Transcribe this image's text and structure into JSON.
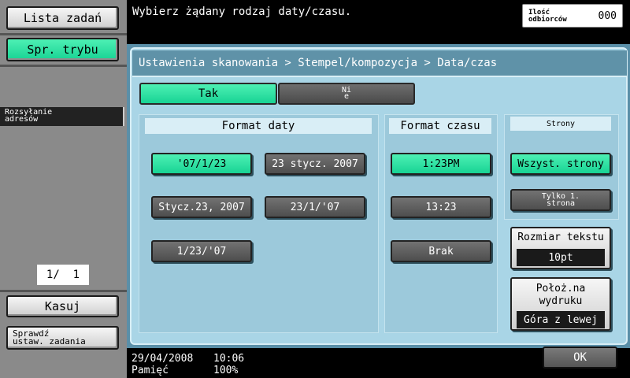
{
  "sidebar": {
    "job_list": "Lista zadań",
    "mode_check": "Spr. trybu",
    "address_broadcast": "Rozsyłanie\nadresów",
    "page_indicator": "1/  1",
    "delete": "Kasuj",
    "check_job_settings": "Sprawdź\nustaw. zadania"
  },
  "top": {
    "message": "Wybierz żądany rodzaj daty/czasu.",
    "recipients_label": "Ilość\nodbiorców",
    "recipients_count": "000"
  },
  "breadcrumb": "Ustawienia skanowania > Stempel/kompozycja > Data/czas",
  "toggle": {
    "yes": "Tak",
    "no_line1": "Ni",
    "no_line2": "e"
  },
  "date_format": {
    "title": "Format daty",
    "options": [
      "'07/1/23",
      "23 stycz. 2007",
      "Stycz.23, 2007",
      "23/1/'07",
      "1/23/'07"
    ],
    "selected": "'07/1/23"
  },
  "time_format": {
    "title": "Format czasu",
    "options": [
      "1:23PM",
      "13:23",
      "Brak"
    ],
    "selected": "1:23PM"
  },
  "pages": {
    "title": "Strony",
    "all_pages": "Wszyst. strony",
    "first_page_line1": "Tylko 1.",
    "first_page_line2": "strona"
  },
  "text_size": {
    "label": "Rozmiar tekstu",
    "value": "10pt"
  },
  "print_position": {
    "label_line1": "Położ.na",
    "label_line2": "wydruku",
    "value": "Góra z lewej"
  },
  "ok": "OK",
  "status": {
    "date": "29/04/2008",
    "time": "10:06",
    "memory_label": "Pamięć",
    "memory_value": "100%"
  },
  "colors": {
    "selected": "#2ee0a0",
    "panel": "#a9d5e6",
    "header": "#5f92a8"
  }
}
